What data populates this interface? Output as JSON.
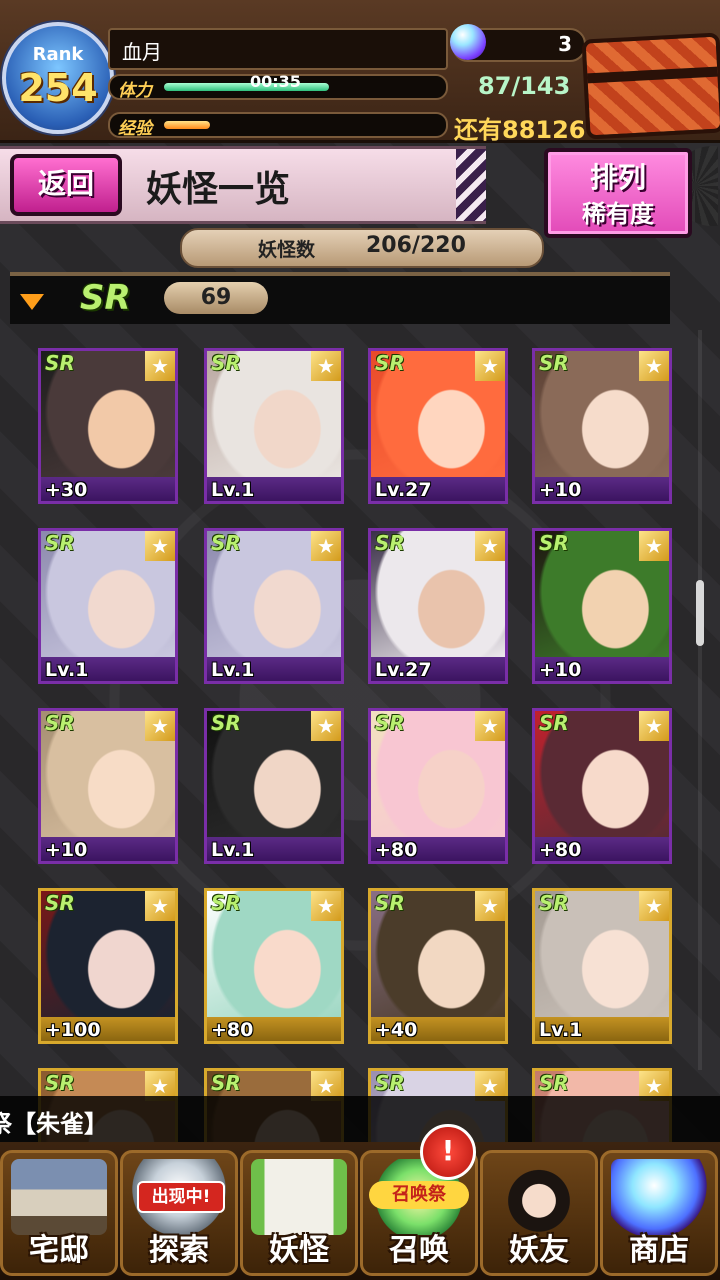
{
  "header": {
    "rank_label": "Rank",
    "rank_value": "254",
    "player_name": "血月",
    "stamina_label": "体力",
    "stamina_timer": "00:35",
    "stamina_value": "87/143",
    "stamina_fraction": 0.61,
    "exp_label": "经验",
    "exp_fraction": 0.17,
    "exp_remaining": "还有88126",
    "orb_count": "3",
    "chest_icon": "treasure-chest-icon"
  },
  "titlebar": {
    "back_label": "返回",
    "page_title": "妖怪一览",
    "sort_label_line1": "排列",
    "sort_label_line2": "稀有度"
  },
  "youkai_count": {
    "label": "妖怪数",
    "value": "206/220"
  },
  "section": {
    "rarity": "SR",
    "count": "69"
  },
  "cards": [
    {
      "rarity": "SR",
      "level": "+30",
      "frame": "purple",
      "palette": [
        "#4a3a3a",
        "#1d1d1d",
        "#f2c9a8"
      ]
    },
    {
      "rarity": "SR",
      "level": "Lv.1",
      "frame": "purple",
      "palette": [
        "#e9e4e0",
        "#b9a7a0",
        "#f1d7c9"
      ]
    },
    {
      "rarity": "SR",
      "level": "Lv.27",
      "frame": "purple",
      "palette": [
        "#ff6b3e",
        "#e84b2a",
        "#ffd6bf"
      ]
    },
    {
      "rarity": "SR",
      "level": "+10",
      "frame": "purple",
      "palette": [
        "#8a6a58",
        "#5b4034",
        "#f6dccb"
      ]
    },
    {
      "rarity": "SR",
      "level": "Lv.1",
      "frame": "purple",
      "palette": [
        "#c9c7df",
        "#8c89ad",
        "#f1d9cf"
      ]
    },
    {
      "rarity": "SR",
      "level": "Lv.1",
      "frame": "purple",
      "palette": [
        "#c9c7df",
        "#8c89ad",
        "#f1d9cf"
      ]
    },
    {
      "rarity": "SR",
      "level": "Lv.27",
      "frame": "purple",
      "palette": [
        "#ece8ec",
        "#3a2f48",
        "#e9c3ac"
      ]
    },
    {
      "rarity": "SR",
      "level": "+10",
      "frame": "purple",
      "palette": [
        "#3d7b2a",
        "#1e1410",
        "#f2d2b0"
      ]
    },
    {
      "rarity": "SR",
      "level": "+10",
      "frame": "purple",
      "palette": [
        "#d8bfa0",
        "#a58e72",
        "#f7dcc6"
      ]
    },
    {
      "rarity": "SR",
      "level": "Lv.1",
      "frame": "purple",
      "palette": [
        "#2c2c2c",
        "#111111",
        "#f0d6c6"
      ]
    },
    {
      "rarity": "SR",
      "level": "+80",
      "frame": "purple",
      "palette": [
        "#f8c6d2",
        "#f2e1c0",
        "#f6d1c8"
      ]
    },
    {
      "rarity": "SR",
      "level": "+80",
      "frame": "purple",
      "palette": [
        "#5a2a34",
        "#c2212d",
        "#f7dacb"
      ]
    },
    {
      "rarity": "SR",
      "level": "+100",
      "frame": "gold",
      "palette": [
        "#1c2330",
        "#7a1818",
        "#f0d6cf"
      ]
    },
    {
      "rarity": "SR",
      "level": "+80",
      "frame": "gold",
      "palette": [
        "#9fd8c4",
        "#ffffff",
        "#f9dacb"
      ]
    },
    {
      "rarity": "SR",
      "level": "+40",
      "frame": "gold",
      "palette": [
        "#4b3c2a",
        "#8a6f86",
        "#f2d8c2"
      ]
    },
    {
      "rarity": "SR",
      "level": "Lv.1",
      "frame": "gold",
      "palette": [
        "#c9c0b8",
        "#a39a92",
        "#f7e1d4"
      ]
    },
    {
      "rarity": "SR",
      "level": "",
      "frame": "gold",
      "palette": [
        "#c58a55",
        "#8a5a2f",
        "#f2d2b6"
      ]
    },
    {
      "rarity": "SR",
      "level": "",
      "frame": "gold",
      "palette": [
        "#9a6c3c",
        "#6a4722",
        "#f2d2b6"
      ]
    },
    {
      "rarity": "SR",
      "level": "",
      "frame": "gold",
      "palette": [
        "#d9d3e4",
        "#9a8fb0",
        "#f2d2b6"
      ]
    },
    {
      "rarity": "SR",
      "level": "",
      "frame": "gold",
      "palette": [
        "#f2b8a8",
        "#c47a6a",
        "#f7dcc6"
      ]
    }
  ],
  "ticker": {
    "text": "祭【朱雀】"
  },
  "nav": [
    {
      "label": "宅邸",
      "icon": "mansion-icon"
    },
    {
      "label": "探索",
      "icon": "crystal-ball-icon",
      "badge": "出现中!"
    },
    {
      "label": "妖怪",
      "icon": "scroll-icon"
    },
    {
      "label": "召唤",
      "icon": "summon-star-icon",
      "badge": "召唤祭",
      "alert": "!"
    },
    {
      "label": "妖友",
      "icon": "catgirl-friend-icon"
    },
    {
      "label": "商店",
      "icon": "magic-orb-shop-icon"
    }
  ],
  "colors": {
    "accent_pink": "#e24ab8",
    "sr_green": "#b9f070",
    "frame_purple": "#7a2ea8",
    "frame_gold": "#d8a92c",
    "stamina_green": "#52e3a0",
    "exp_orange": "#ffb02e"
  }
}
